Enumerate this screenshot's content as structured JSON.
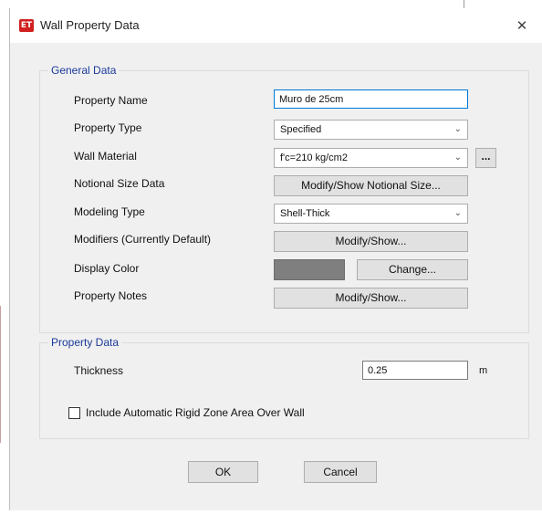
{
  "window": {
    "title": "Wall Property Data",
    "app_icon_text": "ET",
    "close_glyph": "✕"
  },
  "general_data": {
    "group_title": "General Data",
    "property_name_label": "Property Name",
    "property_name_value": "Muro de 25cm",
    "property_type_label": "Property Type",
    "property_type_value": "Specified",
    "wall_material_label": "Wall Material",
    "wall_material_value": "f'c=210 kg/cm2",
    "wall_material_more_label": "...",
    "notional_size_label": "Notional Size Data",
    "notional_size_button": "Modify/Show Notional Size...",
    "modeling_type_label": "Modeling Type",
    "modeling_type_value": "Shell-Thick",
    "modifiers_label": "Modifiers (Currently Default)",
    "modifiers_button": "Modify/Show...",
    "display_color_label": "Display Color",
    "display_color_hex": "#7f7f7f",
    "change_color_button": "Change...",
    "property_notes_label": "Property Notes",
    "property_notes_button": "Modify/Show..."
  },
  "property_data": {
    "group_title": "Property Data",
    "thickness_label": "Thickness",
    "thickness_value": "0.25",
    "thickness_unit": "m",
    "rigid_zone_checkbox_label": "Include Automatic Rigid Zone Area Over Wall",
    "rigid_zone_checked": false
  },
  "footer": {
    "ok_label": "OK",
    "cancel_label": "Cancel"
  },
  "icons": {
    "chevron": "chevron-down-icon"
  }
}
